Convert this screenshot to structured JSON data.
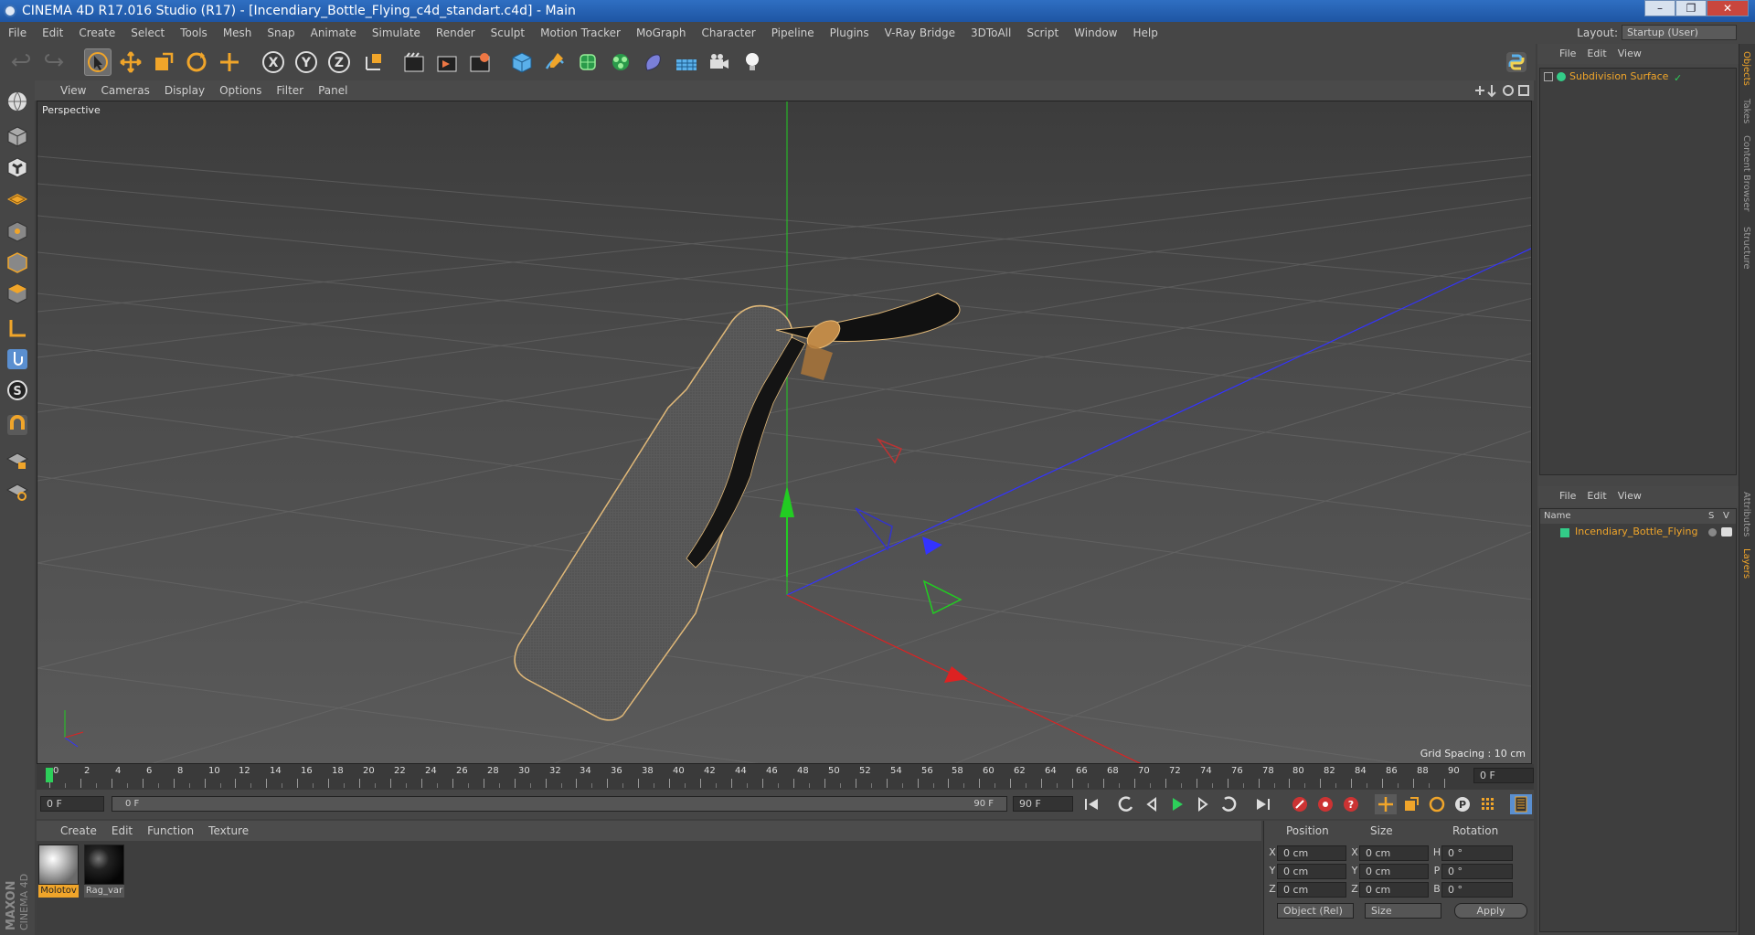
{
  "window": {
    "title": "CINEMA 4D R17.016 Studio (R17) - [Incendiary_Bottle_Flying_c4d_standart.c4d] - Main",
    "controls": [
      "–",
      "❐",
      "✕"
    ]
  },
  "menubar": {
    "items": [
      "File",
      "Edit",
      "Create",
      "Select",
      "Tools",
      "Mesh",
      "Snap",
      "Animate",
      "Simulate",
      "Render",
      "Sculpt",
      "Motion Tracker",
      "MoGraph",
      "Character",
      "Pipeline",
      "Plugins",
      "V-Ray Bridge",
      "3DToAll",
      "Script",
      "Window",
      "Help"
    ],
    "layout_label": "Layout:",
    "layout_value": "Startup (User)"
  },
  "toolbar": {
    "axis_labels": [
      "X",
      "Y",
      "Z"
    ],
    "icons": [
      "undo-icon",
      "redo-icon",
      "live-select-icon",
      "move-icon",
      "scale-icon",
      "rotate-icon",
      "transform-icon",
      "x-axis-icon",
      "y-axis-icon",
      "z-axis-icon",
      "coordinate-system-icon",
      "render-view-icon",
      "render-picture-viewer-icon",
      "render-settings-icon",
      "cube-icon",
      "pen-icon",
      "subdivision-icon",
      "cloner-icon",
      "deformer-icon",
      "floor-icon",
      "camera-icon",
      "light-icon",
      "python-icon"
    ]
  },
  "viewport": {
    "menu": [
      "View",
      "Cameras",
      "Display",
      "Options",
      "Filter",
      "Panel"
    ],
    "label": "Perspective",
    "grid_spacing": "Grid Spacing : 10 cm"
  },
  "timeline": {
    "ticks": [
      "0",
      "2",
      "4",
      "6",
      "8",
      "10",
      "12",
      "14",
      "16",
      "18",
      "20",
      "22",
      "24",
      "26",
      "28",
      "30",
      "32",
      "34",
      "36",
      "38",
      "40",
      "42",
      "44",
      "46",
      "48",
      "50",
      "52",
      "54",
      "56",
      "58",
      "60",
      "62",
      "64",
      "66",
      "68",
      "70",
      "72",
      "74",
      "76",
      "78",
      "80",
      "82",
      "84",
      "86",
      "88",
      "90"
    ],
    "current_frame": "0 F",
    "start_field": "0 F",
    "range_start": "0 F",
    "range_end": "90 F",
    "end_field": "90 F"
  },
  "materials": {
    "menu": [
      "Create",
      "Edit",
      "Function",
      "Texture"
    ],
    "items": [
      {
        "name": "Molotov",
        "color": "#d9d9d9",
        "selected": true
      },
      {
        "name": "Rag_var",
        "color": "#111111",
        "selected": false
      }
    ]
  },
  "coordinates": {
    "headers": [
      "Position",
      "Size",
      "Rotation"
    ],
    "rows": [
      {
        "axis": "X",
        "pos": "0 cm",
        "size_axis": "X",
        "size": "0 cm",
        "rot_axis": "H",
        "rot": "0 °"
      },
      {
        "axis": "Y",
        "pos": "0 cm",
        "size_axis": "Y",
        "size": "0 cm",
        "rot_axis": "P",
        "rot": "0 °"
      },
      {
        "axis": "Z",
        "pos": "0 cm",
        "size_axis": "Z",
        "size": "0 cm",
        "rot_axis": "B",
        "rot": "0 °"
      }
    ],
    "mode": "Object (Rel)",
    "size_mode": "Size",
    "apply": "Apply"
  },
  "objects_panel": {
    "menu": [
      "File",
      "Edit",
      "View"
    ],
    "item": "Subdivision Surface"
  },
  "layers_panel": {
    "menu": [
      "File",
      "Edit",
      "View"
    ],
    "col_name": "Name",
    "col_s": "S",
    "col_v": "V",
    "item": "Incendiary_Bottle_Flying"
  },
  "side_tabs": [
    "Objects",
    "Takes",
    "Content Browser",
    "Structure",
    "Attributes",
    "Layers"
  ],
  "brand": {
    "line1": "MAXON",
    "line2": "CINEMA 4D"
  },
  "colors": {
    "accent": "#f0a52a",
    "x_axis": "#d22",
    "y_axis": "#2c2",
    "z_axis": "#33f",
    "layer_green": "#3c8"
  }
}
